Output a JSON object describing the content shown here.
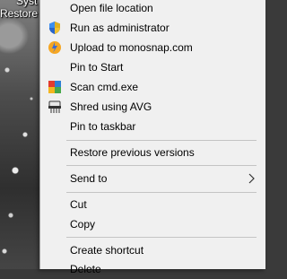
{
  "desktop": {
    "icon_label_line1": "Syst",
    "icon_label_line2": "Restore"
  },
  "menu": {
    "items": [
      {
        "label": "Open file location",
        "icon": ""
      },
      {
        "label": "Run as administrator",
        "icon": "uac-shield-icon"
      },
      {
        "label": "Upload to monosnap.com",
        "icon": "monosnap-icon"
      },
      {
        "label": "Pin to Start",
        "icon": ""
      },
      {
        "label": "Scan cmd.exe",
        "icon": "avg-icon"
      },
      {
        "label": "Shred using AVG",
        "icon": "shredder-icon"
      },
      {
        "label": "Pin to taskbar",
        "icon": ""
      },
      {
        "label": "Restore previous versions",
        "icon": ""
      },
      {
        "label": "Send to",
        "icon": "",
        "submenu": true
      },
      {
        "label": "Cut",
        "icon": ""
      },
      {
        "label": "Copy",
        "icon": ""
      },
      {
        "label": "Create shortcut",
        "icon": ""
      },
      {
        "label": "Delete",
        "icon": ""
      }
    ]
  },
  "colors": {
    "menu_background": "#f0f0f0",
    "separator": "#c4c4c4",
    "text": "#000000"
  }
}
